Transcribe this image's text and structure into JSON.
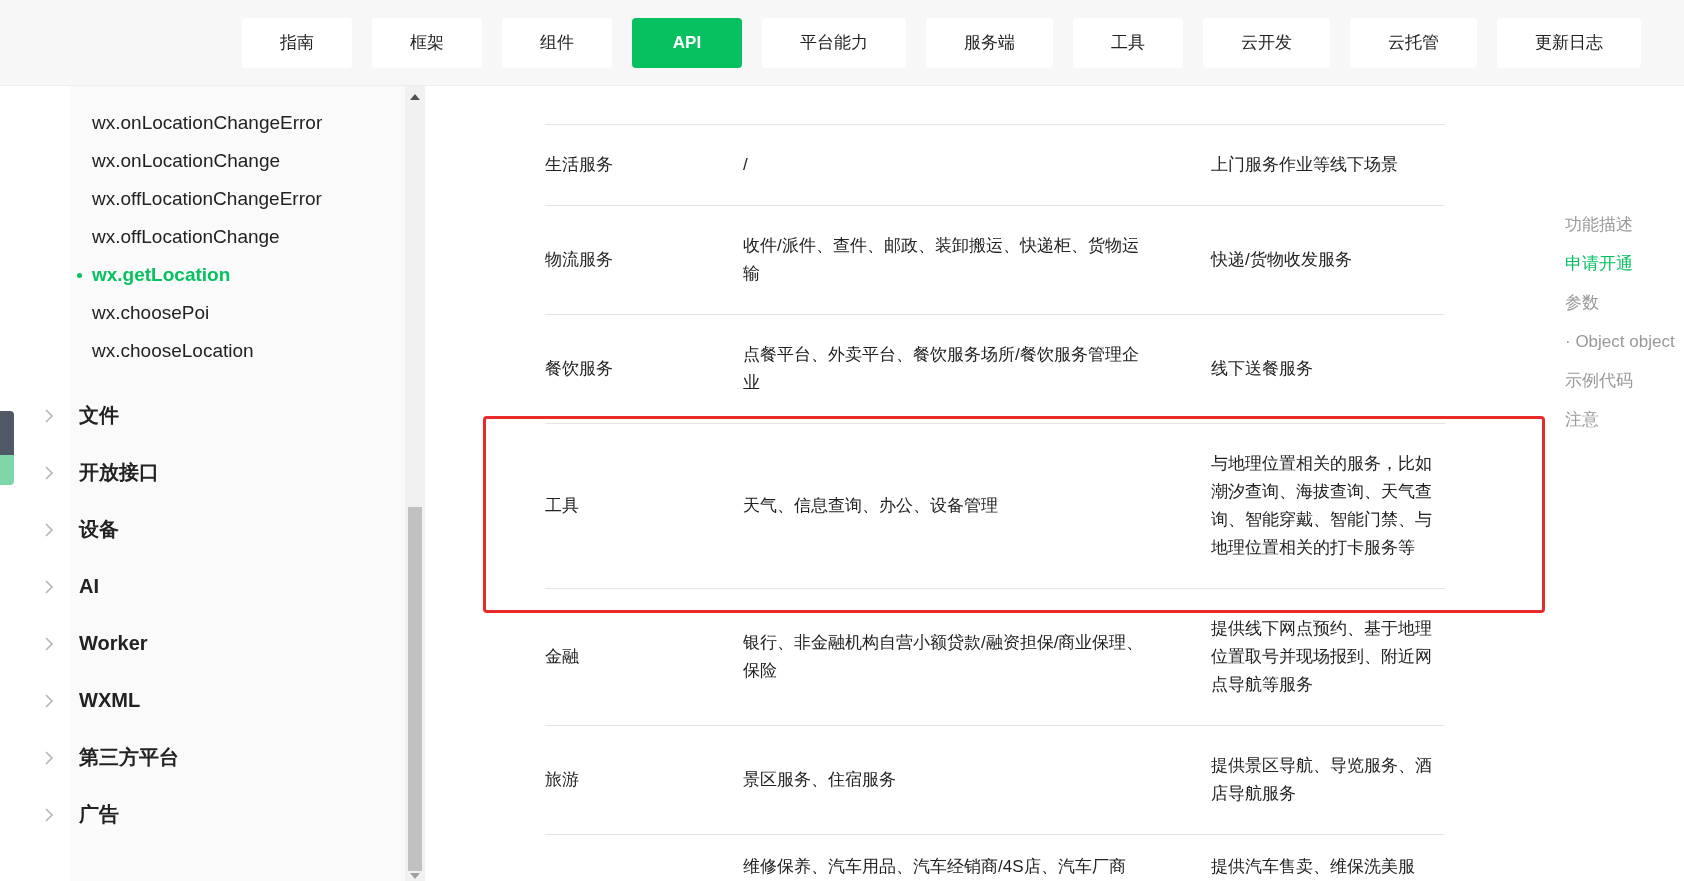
{
  "nav": [
    {
      "label": "指南",
      "selected": false
    },
    {
      "label": "框架",
      "selected": false
    },
    {
      "label": "组件",
      "selected": false
    },
    {
      "label": "API",
      "selected": true
    },
    {
      "label": "平台能力",
      "selected": false
    },
    {
      "label": "服务端",
      "selected": false
    },
    {
      "label": "工具",
      "selected": false
    },
    {
      "label": "云开发",
      "selected": false
    },
    {
      "label": "云托管",
      "selected": false
    },
    {
      "label": "更新日志",
      "selected": false
    }
  ],
  "sidebar": {
    "items": [
      {
        "label": "wx.onLocationChangeError",
        "selected": false
      },
      {
        "label": "wx.onLocationChange",
        "selected": false
      },
      {
        "label": "wx.offLocationChangeError",
        "selected": false
      },
      {
        "label": "wx.offLocationChange",
        "selected": false
      },
      {
        "label": "wx.getLocation",
        "selected": true
      },
      {
        "label": "wx.choosePoi",
        "selected": false
      },
      {
        "label": "wx.chooseLocation",
        "selected": false
      }
    ],
    "sections": [
      {
        "label": "文件",
        "expanded": false
      },
      {
        "label": "开放接口",
        "expanded": false
      },
      {
        "label": "设备",
        "expanded": false
      },
      {
        "label": "AI",
        "expanded": false
      },
      {
        "label": "Worker",
        "expanded": false
      },
      {
        "label": "WXML",
        "expanded": false
      },
      {
        "label": "第三方平台",
        "expanded": false
      },
      {
        "label": "广告",
        "expanded": false
      }
    ]
  },
  "table": {
    "rows": [
      {
        "category": "生活服务",
        "scope": "/",
        "usage": "上门服务作业等线下场景",
        "highlighted": false
      },
      {
        "category": "物流服务",
        "scope": "收件/派件、查件、邮政、装卸搬运、快递柜、货物运输",
        "usage": "快递/货物收发服务",
        "highlighted": false
      },
      {
        "category": "餐饮服务",
        "scope": "点餐平台、外卖平台、餐饮服务场所/餐饮服务管理企业",
        "usage": "线下送餐服务",
        "highlighted": false
      },
      {
        "category": "工具",
        "scope": "天气、信息查询、办公、设备管理",
        "usage": "与地理位置相关的服务，比如潮汐查询、海拔查询、天气查询、智能穿戴、智能门禁、与地理位置相关的打卡服务等",
        "highlighted": true
      },
      {
        "category": "金融",
        "scope": "银行、非金融机构自营小额贷款/融资担保/商业保理、保险",
        "usage": "提供线下网点预约、基于地理位置取号并现场报到、附近网点导航等服务",
        "highlighted": false
      },
      {
        "category": "旅游",
        "scope": "景区服务、住宿服务",
        "usage": "提供景区导航、导览服务、酒店导航服务",
        "highlighted": false
      },
      {
        "scope": "维修保养、汽车用品、汽车经销商/4S店、汽车厂商",
        "usage": "提供汽车售卖、维保洗美服",
        "highlighted": false
      }
    ]
  },
  "toc": [
    {
      "label": "功能描述",
      "selected": false
    },
    {
      "label": "申请开通",
      "selected": true
    },
    {
      "label": "参数",
      "selected": false
    },
    {
      "label": "· Object object",
      "selected": false
    },
    {
      "label": "示例代码",
      "selected": false
    },
    {
      "label": "注意",
      "selected": false
    }
  ]
}
